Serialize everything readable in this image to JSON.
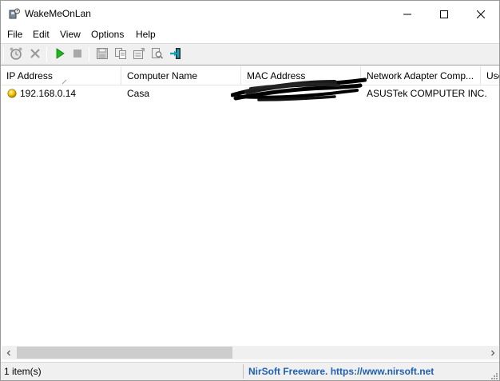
{
  "window": {
    "title": "WakeMeOnLan"
  },
  "menu": {
    "items": [
      "File",
      "Edit",
      "View",
      "Options",
      "Help"
    ]
  },
  "toolbar": {
    "icons": [
      "alarm-clock-icon",
      "delete-x-icon",
      "play-icon",
      "stop-icon",
      "save-icon",
      "copy-icon",
      "properties-icon",
      "search-icon",
      "exit-icon"
    ]
  },
  "table": {
    "columns": [
      "IP Address",
      "Computer Name",
      "MAC Address",
      "Network Adapter Comp...",
      "Use"
    ],
    "rows": [
      {
        "ip": "192.168.0.14",
        "computer_name": "Casa",
        "mac": "",
        "adapter_company": "ASUSTek COMPUTER INC.",
        "status_color": "#f2c200"
      }
    ]
  },
  "status": {
    "item_count": "1 item(s)",
    "link_text": "NirSoft Freeware. https://www.nirsoft.net"
  },
  "colors": {
    "link": "#1e5fb4",
    "play": "#1fb81f",
    "exit": "#1aa3b8"
  }
}
